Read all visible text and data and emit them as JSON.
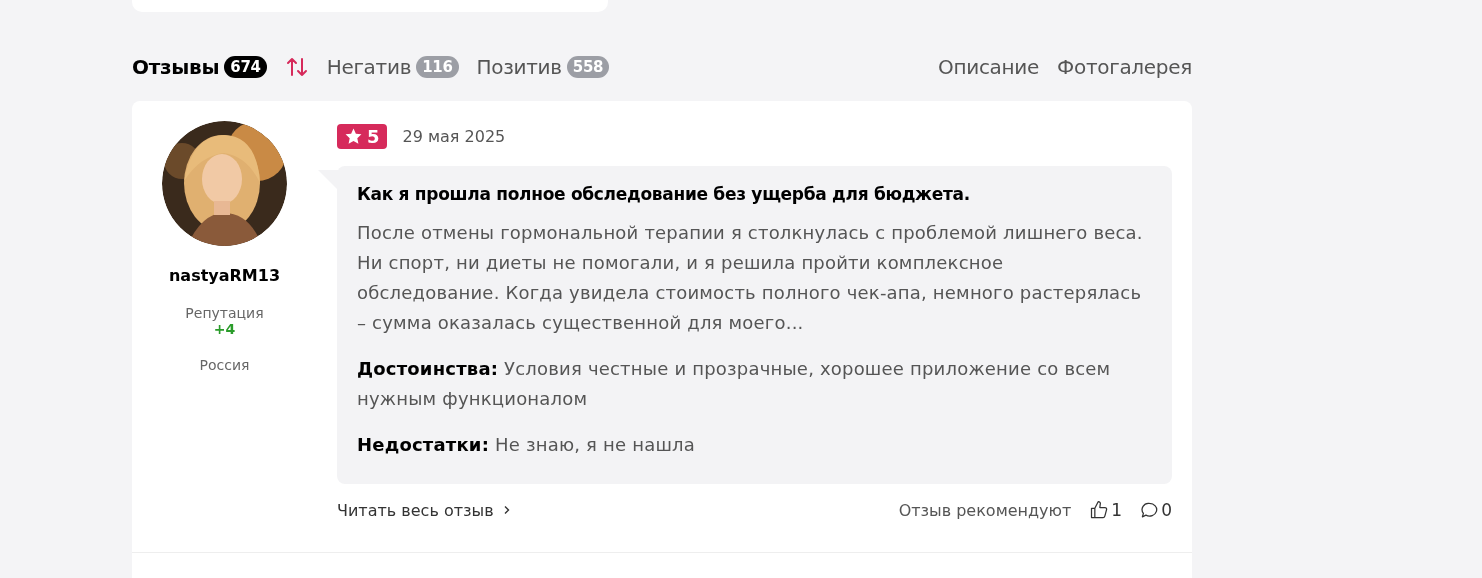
{
  "tabs": [
    {
      "label": "Отзывы",
      "count": "674",
      "selected": true
    },
    {
      "label": "Негатив",
      "count": "116",
      "selected": false
    },
    {
      "label": "Позитив",
      "count": "558",
      "selected": false
    }
  ],
  "links": [
    "Описание",
    "Фотогалерея"
  ],
  "review": {
    "author": "nastyaRM13",
    "reputation_label": "Репутация",
    "reputation": "+4",
    "country": "Россия",
    "rating": "5",
    "date": "29 мая 2025",
    "title": "Как я прошла полное обследование без ущерба для бюджета.",
    "text": "После отмены гормональной терапии я столкнулась с проблемой лишнего веса. Ни спорт, ни диеты не помогали, и я решила пройти комплексное обследование. Когда увидела стоимость полного чек-апа, немного растерялась – сумма оказалась существенной для моего...",
    "pros_label": "Достоинства:",
    "pros": "Условия честные и прозрачные, хорошее приложение со всем нужным функционалом",
    "cons_label": "Недостатки:",
    "cons": "Не знаю, я не нашла",
    "read_more": "Читать весь отзыв",
    "recommend": "Отзыв рекомендуют",
    "likes": "1",
    "comments": "0"
  }
}
